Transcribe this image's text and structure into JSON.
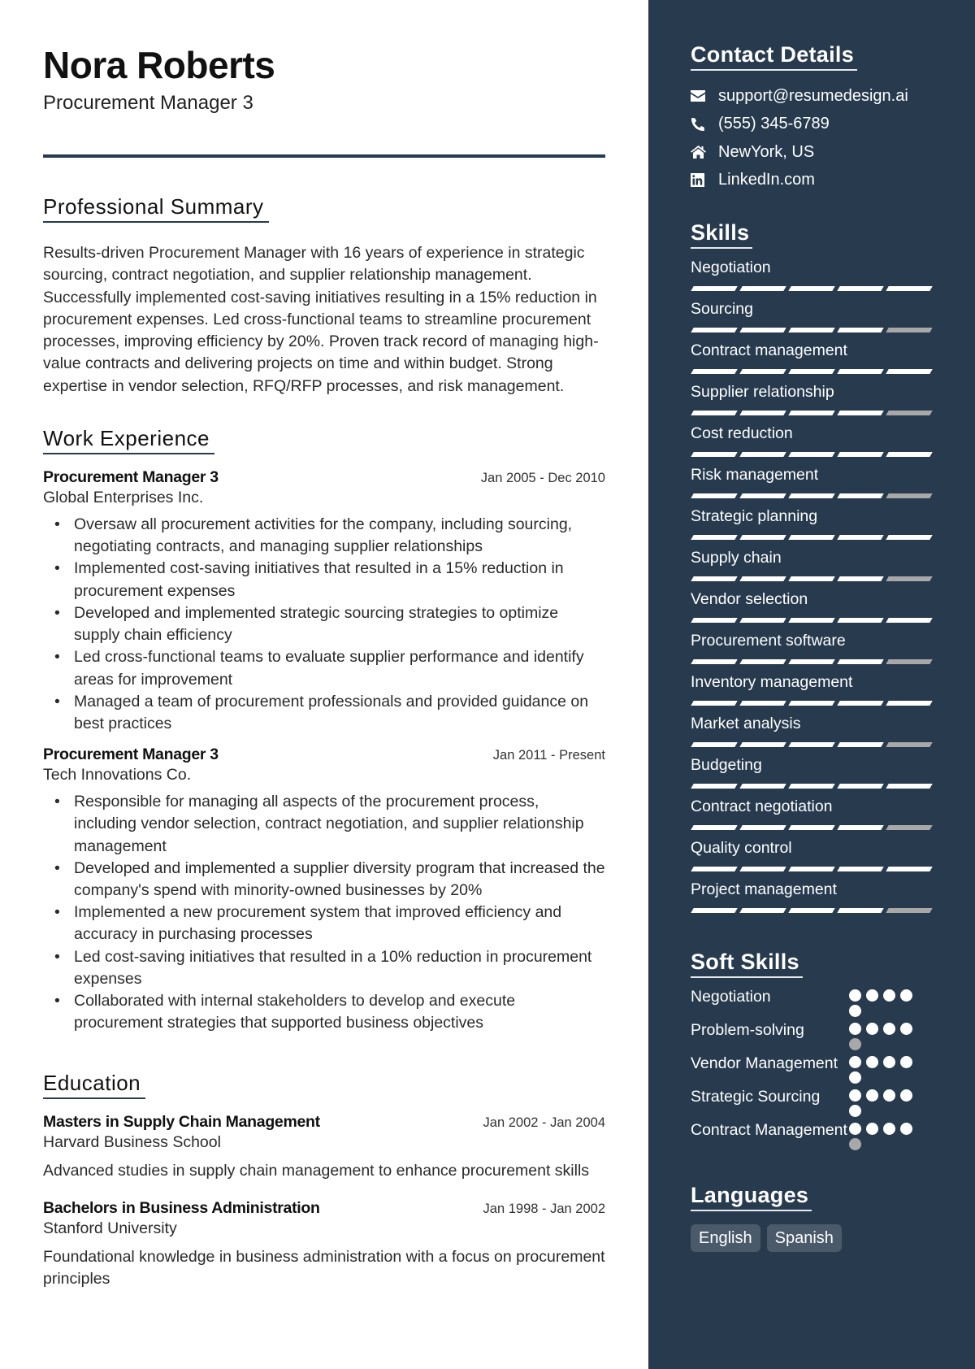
{
  "header": {
    "name": "Nora Roberts",
    "role": "Procurement Manager 3"
  },
  "summary": {
    "title": "Professional Summary",
    "text": "Results-driven Procurement Manager with 16 years of experience in strategic sourcing, contract negotiation, and supplier relationship management. Successfully implemented cost-saving initiatives resulting in a 15% reduction in procurement expenses. Led cross-functional teams to streamline procurement processes, improving efficiency by 20%. Proven track record of managing high-value contracts and delivering projects on time and within budget. Strong expertise in vendor selection, RFQ/RFP processes, and risk management."
  },
  "work": {
    "title": "Work Experience",
    "entries": [
      {
        "role": "Procurement Manager 3",
        "date": "Jan 2005 - Dec 2010",
        "company": "Global Enterprises Inc.",
        "bullets": [
          "Oversaw all procurement activities for the company, including sourcing, negotiating contracts, and managing supplier relationships",
          "Implemented cost-saving initiatives that resulted in a 15% reduction in procurement expenses",
          "Developed and implemented strategic sourcing strategies to optimize supply chain efficiency",
          "Led cross-functional teams to evaluate supplier performance and identify areas for improvement",
          "Managed a team of procurement professionals and provided guidance on best practices"
        ]
      },
      {
        "role": "Procurement Manager 3",
        "date": "Jan 2011 - Present",
        "company": "Tech Innovations Co.",
        "bullets": [
          "Responsible for managing all aspects of the procurement process, including vendor selection, contract negotiation, and supplier relationship management",
          "Developed and implemented a supplier diversity program that increased the company's spend with minority-owned businesses by 20%",
          "Implemented a new procurement system that improved efficiency and accuracy in purchasing processes",
          "Led cost-saving initiatives that resulted in a 10% reduction in procurement expenses",
          "Collaborated with internal stakeholders to develop and execute procurement strategies that supported business objectives"
        ]
      }
    ]
  },
  "education": {
    "title": "Education",
    "entries": [
      {
        "degree": "Masters in Supply Chain Management",
        "date": "Jan 2002 - Jan 2004",
        "school": "Harvard Business School",
        "description": "Advanced studies in supply chain management to enhance procurement skills"
      },
      {
        "degree": "Bachelors in Business Administration",
        "date": "Jan 1998 - Jan 2002",
        "school": "Stanford University",
        "description": "Foundational knowledge in business administration with a focus on procurement principles"
      }
    ]
  },
  "contact": {
    "title": "Contact Details",
    "items": [
      {
        "icon": "envelope-icon",
        "text": "support@resumedesign.ai"
      },
      {
        "icon": "phone-icon",
        "text": "(555) 345-6789"
      },
      {
        "icon": "home-icon",
        "text": "NewYork, US"
      },
      {
        "icon": "linkedin-icon",
        "text": "LinkedIn.com"
      }
    ]
  },
  "skills": {
    "title": "Skills",
    "max": 5,
    "items": [
      {
        "label": "Negotiation",
        "level": 5
      },
      {
        "label": "Sourcing",
        "level": 4
      },
      {
        "label": "Contract management",
        "level": 5
      },
      {
        "label": "Supplier relationship",
        "level": 4
      },
      {
        "label": "Cost reduction",
        "level": 5
      },
      {
        "label": "Risk management",
        "level": 4
      },
      {
        "label": "Strategic planning",
        "level": 5
      },
      {
        "label": "Supply chain",
        "level": 4
      },
      {
        "label": "Vendor selection",
        "level": 5
      },
      {
        "label": "Procurement software",
        "level": 4
      },
      {
        "label": "Inventory management",
        "level": 5
      },
      {
        "label": "Market analysis",
        "level": 4
      },
      {
        "label": "Budgeting",
        "level": 5
      },
      {
        "label": "Contract negotiation",
        "level": 4
      },
      {
        "label": "Quality control",
        "level": 5
      },
      {
        "label": "Project management",
        "level": 4
      }
    ]
  },
  "soft_skills": {
    "title": "Soft Skills",
    "max": 5,
    "items": [
      {
        "label": "Negotiation",
        "level": 5
      },
      {
        "label": "Problem-solving",
        "level": 4
      },
      {
        "label": "Vendor Management",
        "level": 5
      },
      {
        "label": "Strategic Sourcing",
        "level": 5
      },
      {
        "label": "Contract Management",
        "level": 4
      }
    ]
  },
  "languages": {
    "title": "Languages",
    "items": [
      "English",
      "Spanish"
    ]
  },
  "colors": {
    "sidebar_bg": "#273a4e",
    "accent": "#273a4e",
    "filled": "#ffffff",
    "empty": "#a8a8a8",
    "lang_chip": "#4a5a6b"
  }
}
